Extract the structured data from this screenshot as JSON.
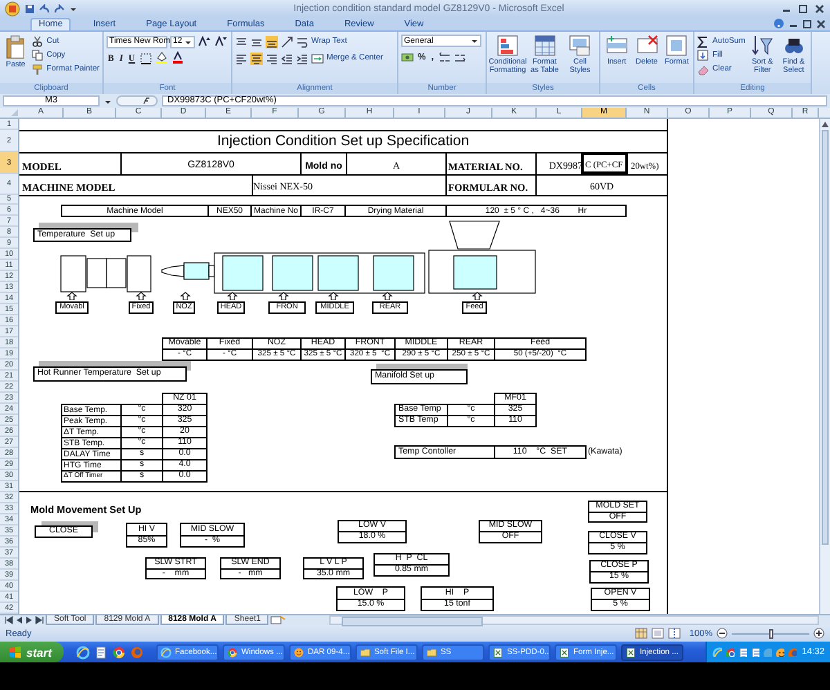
{
  "window": {
    "title": "Injection condition standard model GZ8129V0 - Microsoft Excel"
  },
  "ribbon": {
    "tabs": [
      {
        "label": "Home",
        "selected": true
      },
      {
        "label": "Insert",
        "selected": false
      },
      {
        "label": "Page Layout",
        "selected": false
      },
      {
        "label": "Formulas",
        "selected": false
      },
      {
        "label": "Data",
        "selected": false
      },
      {
        "label": "Review",
        "selected": false
      },
      {
        "label": "View",
        "selected": false
      }
    ],
    "groups": [
      {
        "kind": "clipboard",
        "label": "Clipboard",
        "buttons": [
          "Paste",
          "Cut",
          "Copy",
          "Format Painter"
        ]
      },
      {
        "kind": "font",
        "label": "Font",
        "font_name": "Times New Rom",
        "font_size": "12",
        "buttons": [
          "B",
          "I",
          "U"
        ]
      },
      {
        "kind": "alignment",
        "label": "Alignment",
        "buttons": [
          "Wrap Text",
          "Merge & Center"
        ]
      },
      {
        "kind": "number",
        "label": "Number",
        "format": "General",
        "buttons": [
          "%",
          ","
        ]
      },
      {
        "kind": "styles",
        "label": "Styles",
        "buttons": [
          "Conditional Formatting",
          "Format as Table",
          "Cell Styles"
        ]
      },
      {
        "kind": "cells",
        "label": "Cells",
        "buttons": [
          "Insert",
          "Delete",
          "Format"
        ]
      },
      {
        "kind": "editing",
        "label": "Editing",
        "buttons": [
          "AutoSum",
          "Fill",
          "Clear",
          "Sort & Filter",
          "Find & Select"
        ]
      }
    ]
  },
  "formula_bar": {
    "cell_ref": "M3",
    "formula": "DX99873C (PC+CF20wt%)"
  },
  "columns": [
    {
      "label": "A",
      "selected": false
    },
    {
      "label": "B",
      "selected": false
    },
    {
      "label": "C",
      "selected": false
    },
    {
      "label": "D",
      "selected": false
    },
    {
      "label": "E",
      "selected": false
    },
    {
      "label": "F",
      "selected": false
    },
    {
      "label": "G",
      "selected": false
    },
    {
      "label": "H",
      "selected": false
    },
    {
      "label": "I",
      "selected": false
    },
    {
      "label": "J",
      "selected": false
    },
    {
      "label": "K",
      "selected": false
    },
    {
      "label": "L",
      "selected": false
    },
    {
      "label": "M",
      "selected": true
    },
    {
      "label": "N",
      "selected": false
    },
    {
      "label": "O",
      "selected": false
    },
    {
      "label": "P",
      "selected": false
    },
    {
      "label": "Q",
      "selected": false
    },
    {
      "label": "R",
      "selected": false
    }
  ],
  "rows": [
    {
      "label": "1",
      "selected": false
    },
    {
      "label": "2",
      "selected": false
    },
    {
      "label": "3",
      "selected": true
    },
    {
      "label": "4",
      "selected": false
    },
    {
      "label": "5",
      "selected": false
    },
    {
      "label": "6",
      "selected": false
    },
    {
      "label": "7",
      "selected": false
    },
    {
      "label": "8",
      "selected": false
    },
    {
      "label": "9",
      "selected": false
    },
    {
      "label": "10",
      "selected": false
    },
    {
      "label": "11",
      "selected": false
    },
    {
      "label": "12",
      "selected": false
    },
    {
      "label": "13",
      "selected": false
    },
    {
      "label": "14",
      "selected": false
    },
    {
      "label": "15",
      "selected": false
    },
    {
      "label": "16",
      "selected": false
    },
    {
      "label": "17",
      "selected": false
    },
    {
      "label": "18",
      "selected": false
    },
    {
      "label": "19",
      "selected": false
    },
    {
      "label": "20",
      "selected": false
    },
    {
      "label": "21",
      "selected": false
    },
    {
      "label": "22",
      "selected": false
    },
    {
      "label": "23",
      "selected": false
    },
    {
      "label": "24",
      "selected": false
    },
    {
      "label": "25",
      "selected": false
    },
    {
      "label": "26",
      "selected": false
    },
    {
      "label": "27",
      "selected": false
    },
    {
      "label": "28",
      "selected": false
    },
    {
      "label": "29",
      "selected": false
    },
    {
      "label": "30",
      "selected": false
    },
    {
      "label": "31",
      "selected": false
    },
    {
      "label": "32",
      "selected": false
    },
    {
      "label": "33",
      "selected": false
    },
    {
      "label": "34",
      "selected": false
    },
    {
      "label": "35",
      "selected": false
    },
    {
      "label": "36",
      "selected": false
    },
    {
      "label": "37",
      "selected": false
    },
    {
      "label": "38",
      "selected": false
    },
    {
      "label": "39",
      "selected": false
    },
    {
      "label": "40",
      "selected": false
    },
    {
      "label": "41",
      "selected": false
    },
    {
      "label": "42",
      "selected": false
    }
  ],
  "sheet": {
    "title": "Injection Condition Set up Specification",
    "model": {
      "label": "MODEL",
      "value": "GZ8128V0"
    },
    "mold_no": {
      "label": "Mold no",
      "value": "A"
    },
    "material_no": {
      "label": "MATERIAL NO.",
      "value_parts": [
        "DX9987",
        "C (PC+CF",
        "20wt%)"
      ]
    },
    "machine_model": {
      "label": "MACHINE MODEL",
      "value": "Nissei NEX-50"
    },
    "formular_no": {
      "label": "FORMULAR NO.",
      "value": "60VD"
    },
    "info_row": [
      "Machine Model",
      "NEX50",
      "Machine No",
      "IR-C7",
      "Drying Material",
      "120  ± 5 ° C ,   4~36        Hr"
    ],
    "temperature_setup": {
      "title": "Temperature  Set up",
      "drawing_labels": [
        "Movabl",
        "Fixed",
        "NOZ",
        "HEAD",
        "FRON",
        "MIDDLE",
        "REAR",
        "Feed"
      ],
      "columns": [
        "Movable",
        "Fixed",
        "NOZ",
        "HEAD",
        "FRONT",
        "MIDDLE",
        "REAR",
        "Feed"
      ],
      "values": [
        "- °C",
        "- °C",
        "325 ± 5 °C",
        "325 ± 5 °C",
        "320 ± 5  °C",
        "290 ± 5 °C",
        "250 ± 5 °C",
        "50 (+5/-20)  °C"
      ]
    },
    "hot_runner": {
      "title": "Hot Runner Temperature  Set up",
      "column": "NZ 01",
      "rows": [
        {
          "name": "Base Temp.",
          "unit": "°c",
          "value": "320"
        },
        {
          "name": "Peak Temp.",
          "unit": "°c",
          "value": "325"
        },
        {
          "name": "ΔT Temp.",
          "unit": "°c",
          "value": "20"
        },
        {
          "name": "STB Temp.",
          "unit": "°c",
          "value": "110"
        },
        {
          "name": "DALAY Time",
          "unit": "s",
          "value": "0.0"
        },
        {
          "name": "HTG Time",
          "unit": "s",
          "value": "4.0"
        },
        {
          "name": "ΔT Off Timer",
          "unit": "s",
          "value": "0.0"
        }
      ]
    },
    "manifold": {
      "title": "Manifold Set up",
      "column": "MF01",
      "rows": [
        {
          "name": "Base Temp",
          "unit": "°c",
          "value": "325"
        },
        {
          "name": "STB Temp",
          "unit": "°c",
          "value": "110"
        }
      ],
      "controller": {
        "label": "Temp Contoller",
        "value": "110    °C  SET",
        "note": "(Kawata)"
      }
    },
    "mold_movement": {
      "title": "Mold Movement Set Up",
      "close_label": "CLOSE",
      "settings": [
        {
          "label": "HI V",
          "value": "85%"
        },
        {
          "label": "MID SLOW",
          "value": "-  %"
        },
        {
          "label": "LOW V",
          "value": "18.0 %"
        },
        {
          "label": "MID SLOW",
          "value": "OFF"
        },
        {
          "label": "MOLD SET",
          "value": "OFF"
        },
        {
          "label": "CLOSE V",
          "value": "5 %"
        },
        {
          "label": "SLW STRT",
          "value": "-    mm"
        },
        {
          "label": "SLW END",
          "value": "-   mm"
        },
        {
          "label": "L V L P",
          "value": "35.0 mm"
        },
        {
          "label": "H  P  CL",
          "value": "0.85 mm"
        },
        {
          "label": "CLOSE P",
          "value": "15 %"
        },
        {
          "label": "LOW    P",
          "value": "15.0 %"
        },
        {
          "label": "HI    P",
          "value": "15 tonf"
        },
        {
          "label": "OPEN V",
          "value": "5 %"
        }
      ]
    }
  },
  "sheet_tabs": [
    {
      "label": "Soft Tool",
      "selected": false
    },
    {
      "label": "8129 Mold A",
      "selected": false
    },
    {
      "label": "8128 Mold A",
      "selected": true
    },
    {
      "label": "Sheet1",
      "selected": false
    }
  ],
  "status_bar": {
    "status": "Ready",
    "zoom": "100%",
    "zoom_slider": {
      "level": 0.5
    }
  },
  "taskbar": {
    "start": "start",
    "tasks": [
      {
        "label": "Facebook...",
        "selected": false
      },
      {
        "label": "Windows ...",
        "selected": false
      },
      {
        "label": "DAR 09-4...",
        "selected": false
      },
      {
        "label": "Soft File I...",
        "selected": false
      },
      {
        "label": "SS",
        "selected": false
      },
      {
        "label": "SS-PDD-0...",
        "selected": false
      },
      {
        "label": "Form Inje...",
        "selected": false
      },
      {
        "label": "Injection ...",
        "selected": true
      }
    ],
    "clock": "14:32"
  }
}
